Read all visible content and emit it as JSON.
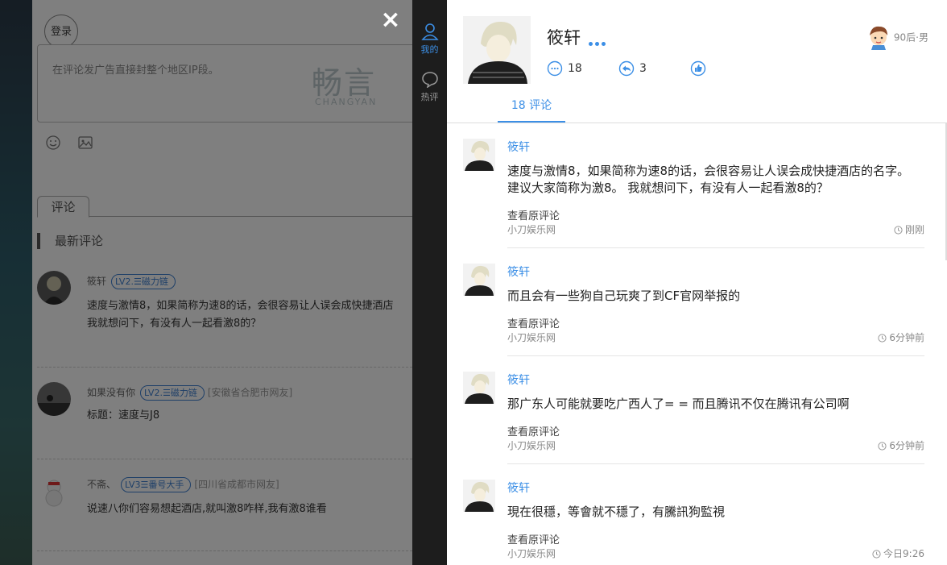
{
  "background": {
    "login_label": "登录",
    "editor_placeholder": "在评论发广告直接封整个地区IP段。",
    "watermark_cn": "畅言",
    "watermark_en": "CHANGYAN",
    "tab_label": "评论",
    "latest_label": "最新评论",
    "comments": [
      {
        "name": "筱轩",
        "badge": "LV2.☰磁力链",
        "location": "",
        "text_lines": [
          "速度与激情8，如果简称为速8的话，会很容易让人误会成快捷酒店",
          "我就想问下，有没有人一起看激8的？"
        ]
      },
      {
        "name": "如果没有你",
        "badge": "LV2.☰磁力链",
        "location": "[安徽省合肥市网友]",
        "text_lines": [
          "标题：速度与J8"
        ]
      },
      {
        "name": "不斋、",
        "badge": "LV3☰番号大手",
        "location": "[四川省成都市网友]",
        "text_lines": [
          "说速八你们容易想起酒店,就叫激8咋样,我有激8谁看"
        ]
      }
    ]
  },
  "close_icon": "×",
  "nav": {
    "mine_label": "我的",
    "hot_label": "热评",
    "accent": "#3c8fe6"
  },
  "profile": {
    "name": "筱轩",
    "comments_count": "18",
    "replies_count": "3",
    "tag": "90后·男",
    "tab_label": "18 评论"
  },
  "comments": [
    {
      "name": "筱轩",
      "text": "速度与激情8，如果简称为速8的话，会很容易让人误会成快捷酒店的名字。建议大家简称为激8。 我就想问下，有没有人一起看激8的？",
      "orig_label": "查看原评论",
      "site": "小刀娱乐网",
      "time": "刚刚"
    },
    {
      "name": "筱轩",
      "text": "而且会有一些狗自己玩爽了到CF官网举报的",
      "orig_label": "查看原评论",
      "site": "小刀娱乐网",
      "time": "6分钟前"
    },
    {
      "name": "筱轩",
      "text": "那广东人可能就要吃广西人了= = 而且腾讯不仅在腾讯有公司啊",
      "orig_label": "查看原评论",
      "site": "小刀娱乐网",
      "time": "6分钟前"
    },
    {
      "name": "筱轩",
      "text": "現在很穩，等會就不穩了，有騰訊狗監視",
      "orig_label": "查看原评论",
      "site": "小刀娱乐网",
      "time": "今日9:26"
    }
  ]
}
